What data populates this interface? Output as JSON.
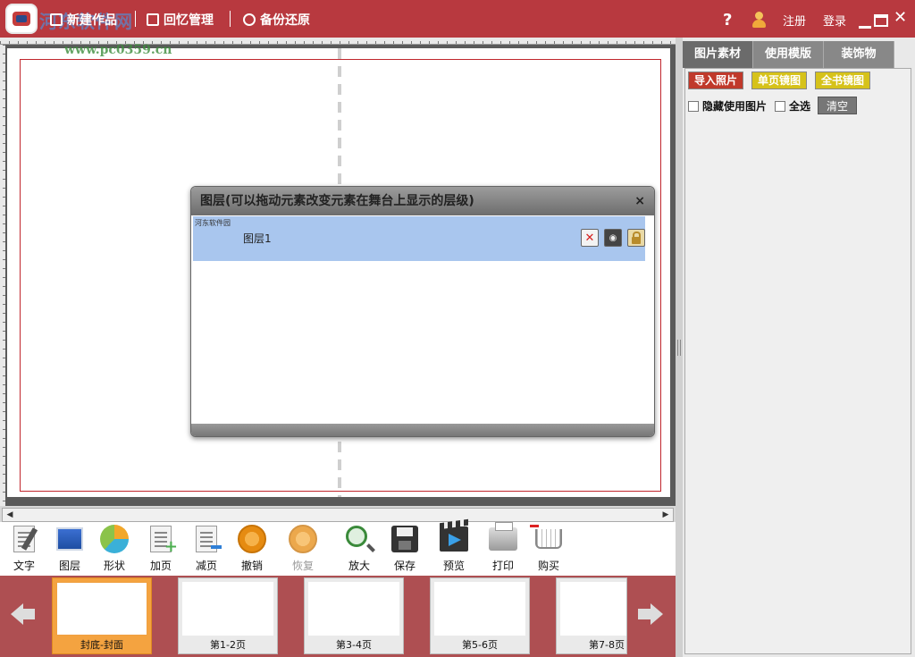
{
  "watermark": {
    "title": "河东软件网",
    "url": "www.pc0359.cn"
  },
  "titlebar": {
    "menu": [
      {
        "label": "新建作品",
        "icon": "new-document-icon"
      },
      {
        "label": "回忆管理",
        "icon": "album-icon"
      },
      {
        "label": "备份还原",
        "icon": "globe-icon"
      }
    ],
    "help": "?",
    "register": "注册",
    "login": "登录",
    "colors": {
      "bar": "#b8393f"
    }
  },
  "layer_dialog": {
    "title": "图层(可以拖动元素改变元素在舞台上显示的层级)",
    "close": "×",
    "layers": [
      {
        "thumb_text": "河东软件园",
        "name": "图层1"
      }
    ]
  },
  "toolbar": [
    {
      "label": "文字",
      "icon": "text-icon",
      "enabled": true
    },
    {
      "label": "图层",
      "icon": "layer-icon",
      "enabled": true
    },
    {
      "label": "形状",
      "icon": "shape-icon",
      "enabled": true
    },
    {
      "label": "加页",
      "icon": "add-page-icon",
      "enabled": true
    },
    {
      "label": "减页",
      "icon": "remove-page-icon",
      "enabled": true
    },
    {
      "label": "撤销",
      "icon": "undo-icon",
      "enabled": true
    },
    {
      "label": "恢复",
      "icon": "redo-icon",
      "enabled": false
    },
    {
      "label": "放大",
      "icon": "zoom-in-icon",
      "enabled": true
    },
    {
      "label": "保存",
      "icon": "save-icon",
      "enabled": true
    },
    {
      "label": "预览",
      "icon": "preview-icon",
      "enabled": true
    },
    {
      "label": "打印",
      "icon": "print-icon",
      "enabled": true
    },
    {
      "label": "购买",
      "icon": "cart-icon",
      "enabled": true
    }
  ],
  "pages": [
    {
      "label": "封底-封面",
      "active": true
    },
    {
      "label": "第1-2页",
      "active": false
    },
    {
      "label": "第3-4页",
      "active": false
    },
    {
      "label": "第5-6页",
      "active": false
    },
    {
      "label": "第7-8页",
      "active": false
    }
  ],
  "right_panel": {
    "tabs": [
      {
        "label": "图片素材",
        "active": true
      },
      {
        "label": "使用模版",
        "active": false
      },
      {
        "label": "装饰物",
        "active": false
      }
    ],
    "import_btn": "导入照片",
    "single_page_btn": "单页镜图",
    "whole_book_btn": "全书镜图",
    "hide_used_label": "隐藏使用图片",
    "select_all_label": "全选",
    "clear_btn": "清空"
  }
}
